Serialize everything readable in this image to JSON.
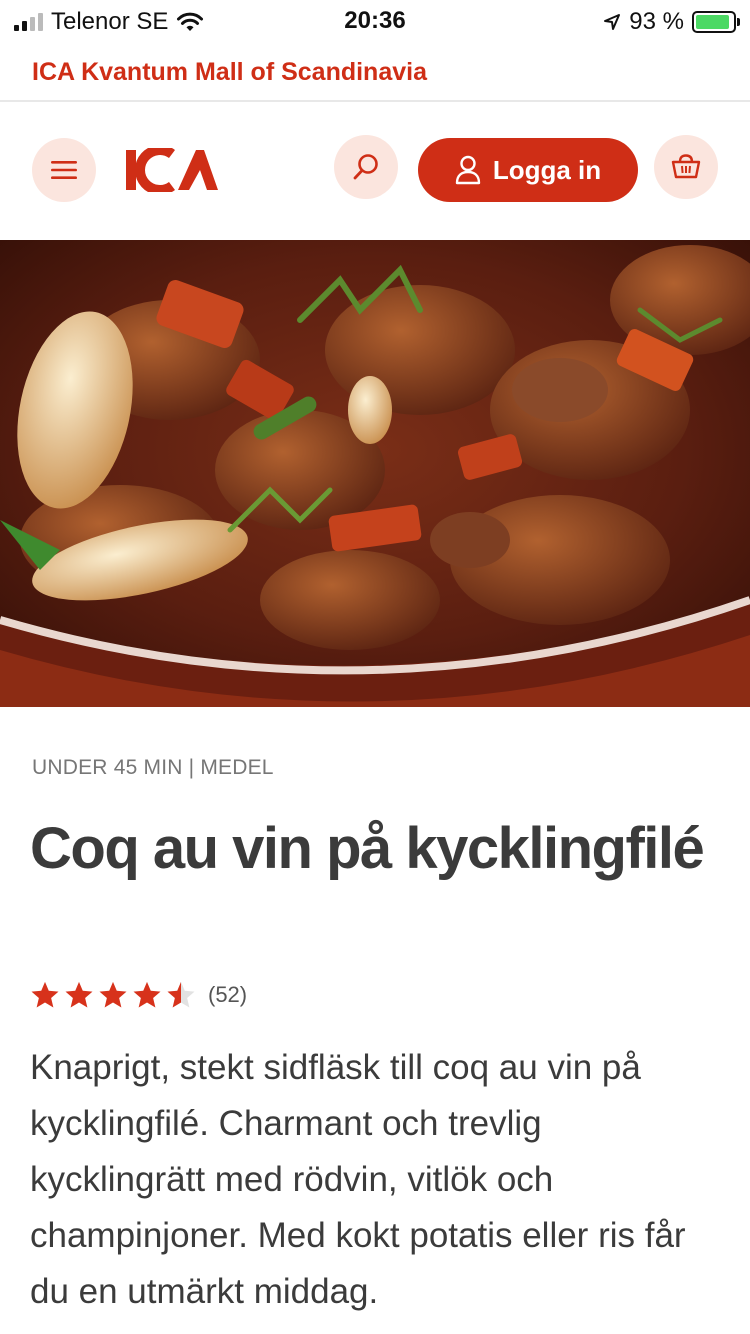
{
  "status_bar": {
    "carrier": "Telenor SE",
    "time": "20:36",
    "battery": "93 %"
  },
  "store": {
    "name": "ICA Kvantum Mall of Scandinavia"
  },
  "header": {
    "logo_text": "ICA",
    "login_label": "Logga in",
    "icons": [
      "menu-icon",
      "search-icon",
      "user-icon",
      "basket-icon"
    ]
  },
  "recipe": {
    "meta": "UNDER 45 MIN | MEDEL",
    "title": "Coq au vin på kycklingfilé",
    "rating": {
      "stars": 4.5,
      "max": 5,
      "count": "(52)"
    },
    "description": "Knaprigt, stekt sidfläsk till coq au vin på kycklingfilé. Charmant och trevlig kycklingrätt med rödvin, vitlök och champinjoner. Med kokt potatis eller ris får du en utmärkt middag."
  },
  "colors": {
    "brand_red": "#cf2e16",
    "brand_tint": "#fbe5de",
    "star": "#d7321b"
  }
}
